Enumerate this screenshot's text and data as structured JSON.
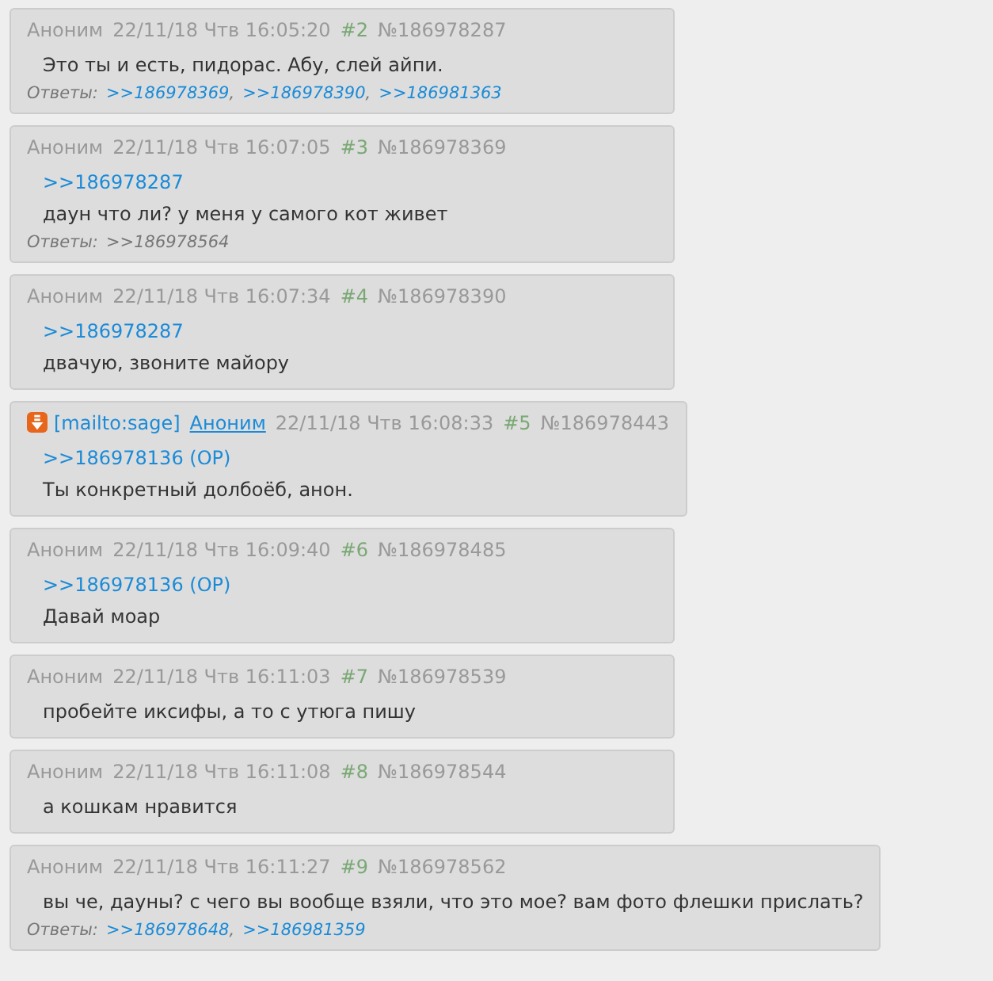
{
  "posts": [
    {
      "name": "Аноним",
      "date": "22/11/18 Чтв 16:05:20",
      "number": "#2",
      "id": "№186978287",
      "text": "Это ты и есть, пидорас. Абу, слей айпи.",
      "replies_label": "Ответы:",
      "replies": [
        {
          "link": ">>186978369",
          "visited": false,
          "separator": ","
        },
        {
          "link": ">>186978390",
          "visited": false,
          "separator": ","
        },
        {
          "link": ">>186981363",
          "visited": false
        }
      ]
    },
    {
      "name": "Аноним",
      "date": "22/11/18 Чтв 16:07:05",
      "number": "#3",
      "id": "№186978369",
      "quotes": [
        ">>186978287"
      ],
      "text": "даун что ли? у меня у самого кот живет",
      "replies_label": "Ответы:",
      "replies": [
        {
          "link": ">>186978564",
          "visited": true
        }
      ]
    },
    {
      "name": "Аноним",
      "date": "22/11/18 Чтв 16:07:34",
      "number": "#4",
      "id": "№186978390",
      "quotes": [
        ">>186978287"
      ],
      "text": "двачую, звоните майору"
    },
    {
      "sage": true,
      "email": "[mailto:sage]",
      "name": "Аноним",
      "date": "22/11/18 Чтв 16:08:33",
      "number": "#5",
      "id": "№186978443",
      "quotes": [
        ">>186978136 (OP)"
      ],
      "text": "Ты конкретный долбоёб, анон."
    },
    {
      "name": "Аноним",
      "date": "22/11/18 Чтв 16:09:40",
      "number": "#6",
      "id": "№186978485",
      "quotes": [
        ">>186978136 (OP)"
      ],
      "text": "Давай моар"
    },
    {
      "name": "Аноним",
      "date": "22/11/18 Чтв 16:11:03",
      "number": "#7",
      "id": "№186978539",
      "text": "пробейте иксифы, а то с утюга пишу"
    },
    {
      "name": "Аноним",
      "date": "22/11/18 Чтв 16:11:08",
      "number": "#8",
      "id": "№186978544",
      "text": "а кошкам нравится"
    },
    {
      "name": "Аноним",
      "date": "22/11/18 Чтв 16:11:27",
      "number": "#9",
      "id": "№186978562",
      "text": "вы че, дауны? с чего вы вообще взяли, что это мое? вам фото флешки прислать?",
      "replies_label": "Ответы:",
      "replies": [
        {
          "link": ">>186978648",
          "visited": false,
          "separator": ","
        },
        {
          "link": ">>186981359",
          "visited": false
        }
      ]
    }
  ]
}
